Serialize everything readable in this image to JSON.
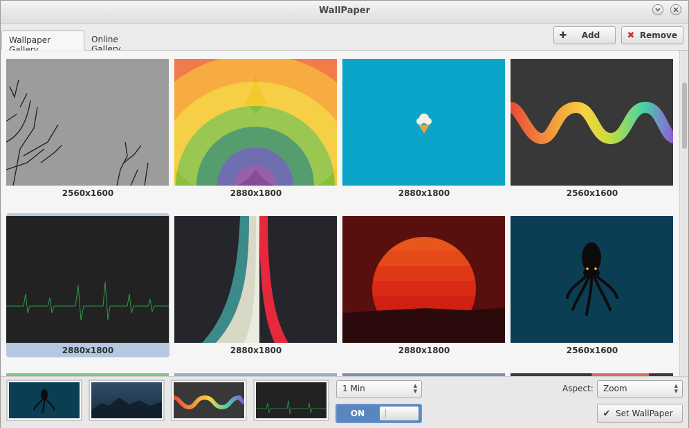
{
  "window": {
    "title": "WallPaper"
  },
  "tabs": [
    {
      "label": "Wallpaper Gallery",
      "active": true
    },
    {
      "label": "Online Gallery",
      "active": false
    }
  ],
  "toolbar": {
    "add_label": "Add",
    "remove_label": "Remove"
  },
  "gallery": [
    {
      "resolution": "2560x1600",
      "image": "bare-tree-branches",
      "selected": false
    },
    {
      "resolution": "2880x1800",
      "image": "rainbow-arcs",
      "selected": false
    },
    {
      "resolution": "2880x1800",
      "image": "ice-cream-cone",
      "selected": false
    },
    {
      "resolution": "2560x1600",
      "image": "color-wave",
      "selected": false
    },
    {
      "resolution": "2880x1800",
      "image": "heartbeat-line",
      "selected": true
    },
    {
      "resolution": "2880x1800",
      "image": "retro-stripes",
      "selected": false
    },
    {
      "resolution": "2880x1800",
      "image": "red-sunset",
      "selected": false
    },
    {
      "resolution": "2560x1600",
      "image": "octopus",
      "selected": false
    }
  ],
  "bottom": {
    "interval": "1 Min",
    "toggle_label": "ON",
    "aspect_label": "Aspect:",
    "aspect_value": "Zoom",
    "set_label": "Set WallPaper",
    "queue": [
      "octopus",
      "mountains",
      "color-wave",
      "heartbeat-line"
    ]
  },
  "colors": {
    "selection": "#b4c8e0",
    "toggle": "#5a86c0",
    "remove_icon": "#d0342c"
  }
}
